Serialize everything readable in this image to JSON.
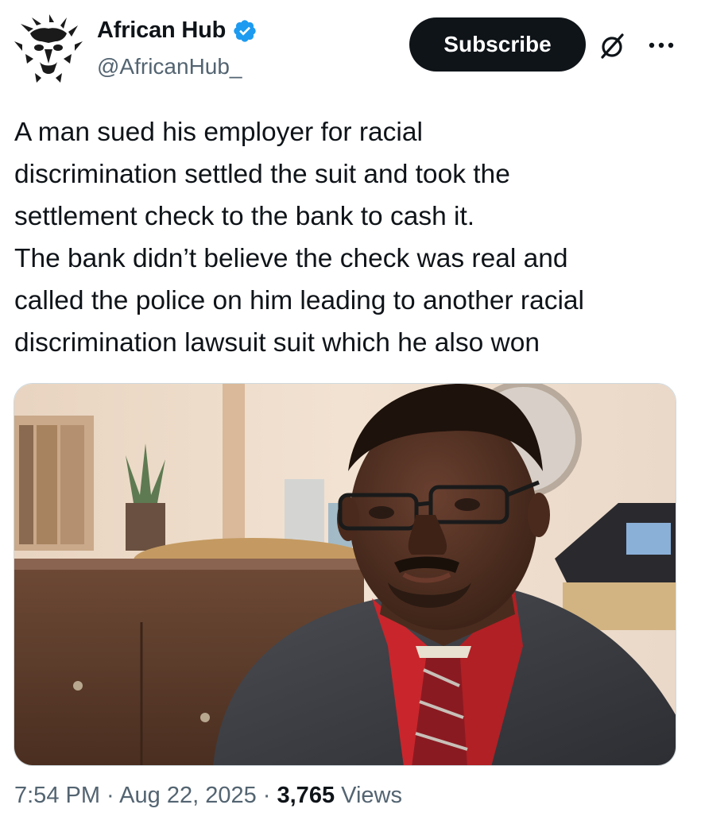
{
  "author": {
    "name": "African Hub",
    "handle": "@AfricanHub_",
    "verified": true,
    "avatar_icon": "lion-head-logo-icon",
    "verified_color": "#1d9bf0"
  },
  "actions": {
    "subscribe_label": "Subscribe",
    "grok_icon": "grok-slash-circle-icon",
    "more_icon": "more-dots-icon"
  },
  "tweet": {
    "text": "A man sued his employer for racial\ndiscrimination settled the suit and took the\nsettlement check to the bank to cash it.\nThe bank didn’t believe the check was real and\ncalled the police on him leading to another racial\ndiscrimination lawsuit suit which he also won"
  },
  "media": {
    "type": "photo",
    "subject": "man-in-suit-with-glasses"
  },
  "meta": {
    "time": "7:54 PM",
    "separator": " · ",
    "date": "Aug 22, 2025",
    "views_count": "3,765",
    "views_label": " Views"
  },
  "colors": {
    "text": "#0f1419",
    "secondary": "#536471",
    "button_bg": "#0f1419",
    "button_text": "#ffffff"
  }
}
